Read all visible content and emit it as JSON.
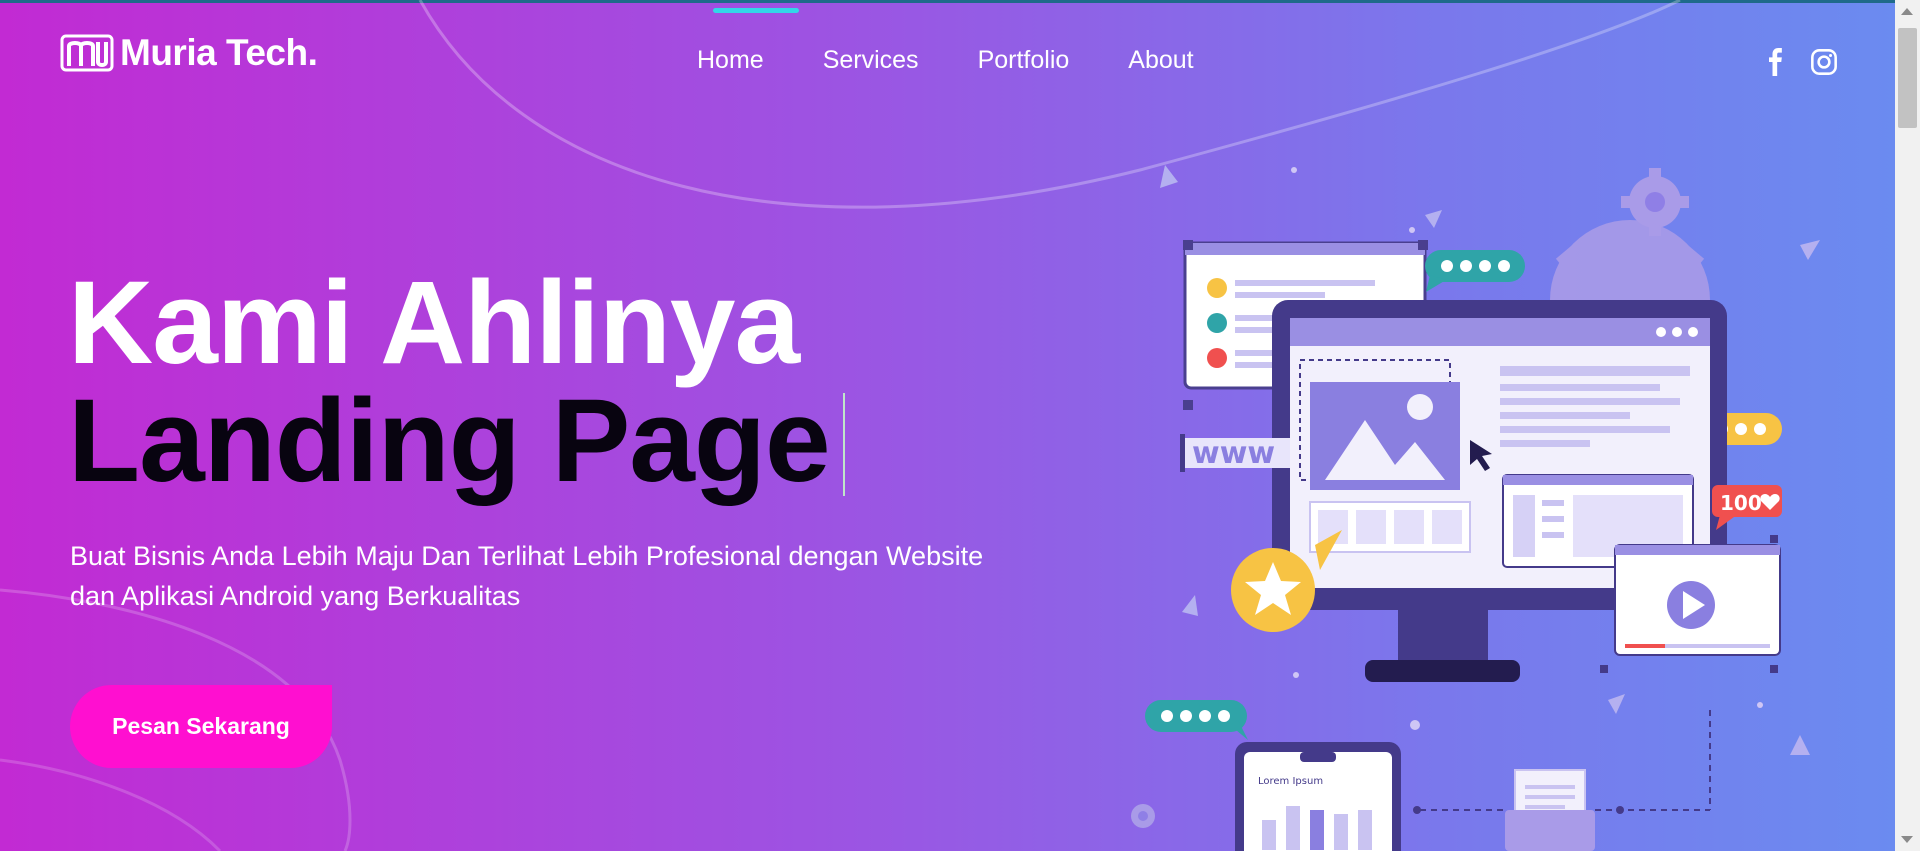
{
  "brand": {
    "name": "Muria Tech."
  },
  "nav": {
    "items": [
      {
        "label": "Home",
        "active": true
      },
      {
        "label": "Services",
        "active": false
      },
      {
        "label": "Portfolio",
        "active": false
      },
      {
        "label": "About",
        "active": false
      }
    ]
  },
  "social": {
    "icons": [
      "facebook-icon",
      "instagram-icon"
    ]
  },
  "hero": {
    "title_line1": "Kami Ahlinya",
    "title_line2": "Landing Page",
    "subtitle_line1": "Buat Bisnis Anda Lebih Maju Dan Terlihat Lebih Profesional dengan Website",
    "subtitle_line2": "dan Aplikasi Android yang Berkualitas",
    "cta_label": "Pesan Sekarang"
  },
  "illustration": {
    "www_label": "www",
    "counter_label": "100",
    "phone_label": "Lorem Ipsum"
  },
  "colors": {
    "gradient_start": "#c22ad3",
    "gradient_end": "#6a8cf0",
    "cta": "#ff0fd0",
    "nav_indicator": "#33d6e8",
    "illustration_primary": "#8a7fe0"
  }
}
